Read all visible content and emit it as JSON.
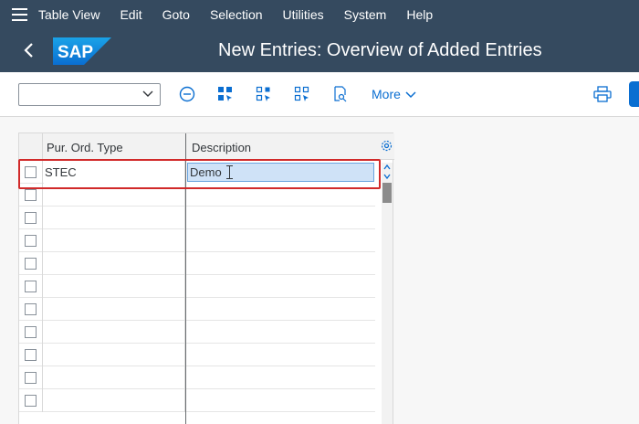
{
  "menu": {
    "items": [
      "Table View",
      "Edit",
      "Goto",
      "Selection",
      "Utilities",
      "System",
      "Help"
    ]
  },
  "header": {
    "logo_text": "SAP",
    "title": "New Entries: Overview of Added Entries"
  },
  "toolbar": {
    "dropdown_value": "",
    "more_label": "More",
    "icons": [
      "minus-circle-icon",
      "select-all-icon",
      "deselect-icon",
      "select-block-icon",
      "find-icon",
      "print-icon"
    ]
  },
  "table": {
    "columns": [
      "Pur. Ord. Type",
      "Description"
    ],
    "rows": [
      {
        "type": "STEC",
        "description": "Demo"
      },
      {
        "type": "",
        "description": ""
      },
      {
        "type": "",
        "description": ""
      },
      {
        "type": "",
        "description": ""
      },
      {
        "type": "",
        "description": ""
      },
      {
        "type": "",
        "description": ""
      },
      {
        "type": "",
        "description": ""
      },
      {
        "type": "",
        "description": ""
      },
      {
        "type": "",
        "description": ""
      },
      {
        "type": "",
        "description": ""
      },
      {
        "type": "",
        "description": ""
      }
    ]
  },
  "colors": {
    "shell": "#354a5f",
    "accent": "#0a6ed1",
    "highlight_border": "#d12a2a",
    "selection": "#cfe2f7"
  }
}
